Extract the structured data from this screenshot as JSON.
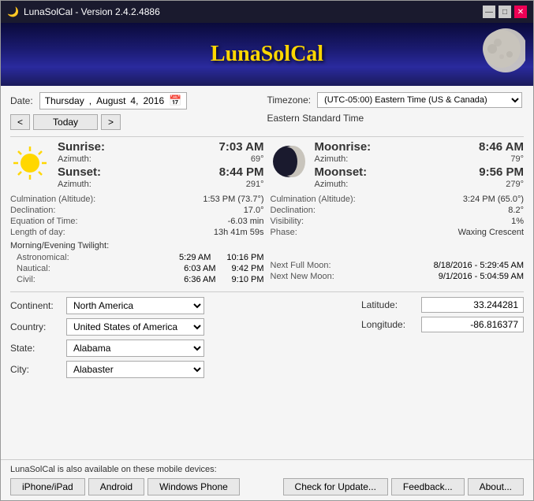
{
  "titleBar": {
    "title": "LunaSolCal - Version 2.4.2.4886",
    "controls": [
      "—",
      "□",
      "✕"
    ]
  },
  "header": {
    "title": "LunaSolCal"
  },
  "dateSection": {
    "label": "Date:",
    "dayOfWeek": "Thursday",
    "month": "August",
    "day": "4,",
    "year": "2016",
    "prevBtn": "<",
    "todayBtn": "Today",
    "nextBtn": ">"
  },
  "timezoneSection": {
    "label": "Timezone:",
    "value": "(UTC-05:00) Eastern Time (US & Canada)",
    "sublabel": "Eastern Standard Time"
  },
  "sunData": {
    "riseLabel": "Sunrise:",
    "riseTime": "7:03 AM",
    "riseAzLabel": "Azimuth:",
    "riseAzValue": "69°",
    "setLabel": "Sunset:",
    "setTime": "8:44 PM",
    "setAzLabel": "Azimuth:",
    "setAzValue": "291°"
  },
  "moonData": {
    "riseLabel": "Moonrise:",
    "riseTime": "8:46 AM",
    "riseAzLabel": "Azimuth:",
    "riseAzValue": "79°",
    "setLabel": "Moonset:",
    "setTime": "9:56 PM",
    "setAzLabel": "Azimuth:",
    "setAzValue": "279°"
  },
  "sunDetails": {
    "culminationLabel": "Culmination (Altitude):",
    "culminationValue": "1:53 PM (73.7°)",
    "declinationLabel": "Declination:",
    "declinationValue": "17.0°",
    "equationLabel": "Equation of Time:",
    "equationValue": "-6.03 min",
    "lengthLabel": "Length of day:",
    "lengthValue": "13h 41m 59s"
  },
  "moonDetails": {
    "culminationLabel": "Culmination (Altitude):",
    "culminationValue": "3:24 PM (65.0°)",
    "declinationLabel": "Declination:",
    "declinationValue": "8.2°",
    "visibilityLabel": "Visibility:",
    "visibilityValue": "1%",
    "phaseLabel": "Phase:",
    "phaseValue": "Waxing Crescent"
  },
  "twilight": {
    "title": "Morning/Evening Twilight:",
    "astronomical": {
      "label": "Astronomical:",
      "morning": "5:29 AM",
      "evening": "10:16 PM"
    },
    "nautical": {
      "label": "Nautical:",
      "morning": "6:03 AM",
      "evening": "9:42 PM"
    },
    "civil": {
      "label": "Civil:",
      "morning": "6:36 AM",
      "evening": "9:10 PM"
    }
  },
  "nextMoon": {
    "fullLabel": "Next Full Moon:",
    "fullValue": "8/18/2016 - 5:29:45 AM",
    "newLabel": "Next New Moon:",
    "newValue": "9/1/2016 - 5:04:59 AM"
  },
  "location": {
    "continentLabel": "Continent:",
    "continentValue": "North America",
    "countryLabel": "Country:",
    "countryValue": "United States of America",
    "stateLabel": "State:",
    "stateValue": "Alabama",
    "cityLabel": "City:",
    "cityValue": "Alabaster",
    "latitudeLabel": "Latitude:",
    "latitudeValue": "33.244281",
    "longitudeLabel": "Longitude:",
    "longitudeValue": "-86.816377"
  },
  "footer": {
    "mobileText": "LunaSolCal is also available on these mobile devices:",
    "iphoneBtn": "iPhone/iPad",
    "androidBtn": "Android",
    "windowsPhoneBtn": "Windows Phone",
    "checkBtn": "Check for Update...",
    "feedbackBtn": "Feedback...",
    "aboutBtn": "About..."
  }
}
